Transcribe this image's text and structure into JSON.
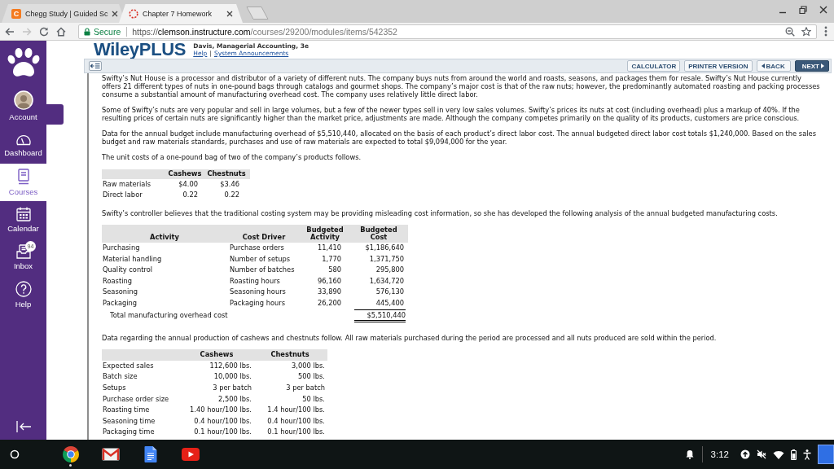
{
  "browser": {
    "tabs": [
      {
        "kind": "letter",
        "icon_text": "C",
        "title": "Chegg Study | Guided Sc",
        "selected": false
      },
      {
        "kind": "loading",
        "title": "Chapter 7 Homework",
        "selected": true
      }
    ],
    "forward_disabled": true,
    "secure_label": "Secure",
    "url": {
      "scheme": "https://",
      "host": "clemson.instructure.com",
      "path": "/courses/29200/modules/items/542352"
    }
  },
  "sidebar": {
    "items": [
      {
        "kind": "avatar",
        "label": "Account",
        "selected": false,
        "hovered": true
      },
      {
        "kind": "dashboard",
        "label": "Dashboard",
        "selected": false,
        "hovered": false
      },
      {
        "kind": "courses",
        "label": "Courses",
        "selected": true,
        "hovered": false
      },
      {
        "kind": "calendar",
        "label": "Calendar",
        "selected": false,
        "hovered": false
      },
      {
        "kind": "inbox",
        "label": "Inbox",
        "badge": "94",
        "selected": false,
        "hovered": false
      },
      {
        "kind": "help",
        "label": "Help",
        "selected": false,
        "hovered": false
      }
    ]
  },
  "header": {
    "logo": "WileyPLUS",
    "subtitle": "Davis, Managerial Accounting, 3e",
    "links": [
      "Help",
      "System Announcements"
    ],
    "link_separator": "|"
  },
  "toolbar": {
    "buttons": [
      {
        "kind": "plain",
        "label": "CALCULATOR"
      },
      {
        "kind": "plain",
        "label": "PRINTER VERSION"
      },
      {
        "kind": "back",
        "label": "BACK"
      },
      {
        "kind": "next",
        "label": "NEXT"
      }
    ]
  },
  "problem": {
    "blocks": [
      {
        "kind": "paragraph",
        "text": "Swifty’s Nut House is a processor and distributor of a variety of different nuts. The company buys nuts from around the world and roasts, seasons, and packages them for resale. Swifty’s Nut House currently offers 21 different types of nuts in one-pound bags through catalogs and gourmet shops. The company’s major cost is that of the raw nuts; however, the predominantly automated roasting and packing processes consume a substantial amount of manufacturing overhead cost. The company uses relatively little direct labor."
      },
      {
        "kind": "paragraph",
        "text": "Some of Swifty’s nuts are very popular and sell in large volumes, but a few of the newer types sell in very low sales volumes. Swifty’s prices its nuts at cost (including overhead) plus a markup of 40%. If the resulting prices of certain nuts are significantly higher than the market price, adjustments are made. Although the company competes primarily on the quality of its products, customers are price conscious."
      },
      {
        "kind": "paragraph",
        "text": "Data for the annual budget include manufacturing overhead of $5,510,440, allocated on the basis of each product’s direct labor cost. The annual budgeted direct labor cost totals $1,240,000. Based on the sales budget and raw materials standards, purchases and use of raw materials are expected to total $9,094,000 for the year."
      },
      {
        "kind": "paragraph",
        "text": "The unit costs of a one-pound bag of two of the company’s products follows."
      },
      {
        "kind": "unit_cost_table",
        "columns": [
          {
            "kind": "label"
          },
          {
            "kind": "amount",
            "label": "Cashews"
          },
          {
            "kind": "amount",
            "label": "Chestnuts"
          }
        ],
        "rows": [
          {
            "label": "Raw materials",
            "values": [
              "$4.00",
              "$3.46"
            ]
          },
          {
            "label": "Direct labor",
            "values": [
              "0.22",
              "0.22"
            ]
          }
        ]
      },
      {
        "kind": "paragraph",
        "text": "Swifty’s controller believes that the traditional costing system may be providing misleading cost information, so she has developed the following analysis of the annual budgeted manufacturing costs."
      },
      {
        "kind": "activity_table",
        "columns": [
          {
            "kind": "label",
            "label": "Activity"
          },
          {
            "kind": "text",
            "label": "Cost Driver"
          },
          {
            "kind": "amount",
            "label": "Budgeted Activity"
          },
          {
            "kind": "amount",
            "label": "Budgeted Cost"
          }
        ],
        "rows": [
          {
            "kind": "item",
            "label": "Purchasing",
            "values": [
              "Purchase orders",
              "11,410",
              "$1,186,640"
            ]
          },
          {
            "kind": "item",
            "label": "Material handling",
            "values": [
              "Number of setups",
              "1,770",
              "1,371,750"
            ]
          },
          {
            "kind": "item",
            "label": "Quality control",
            "values": [
              "Number of batches",
              "580",
              "295,800"
            ]
          },
          {
            "kind": "item",
            "label": "Roasting",
            "values": [
              "Roasting hours",
              "96,160",
              "1,634,720"
            ]
          },
          {
            "kind": "item",
            "label": "Seasoning",
            "values": [
              "Seasoning hours",
              "33,890",
              "576,130"
            ]
          },
          {
            "kind": "item",
            "label": "Packaging",
            "values": [
              "Packaging hours",
              "26,200",
              "445,400"
            ]
          },
          {
            "kind": "total",
            "label": "Total manufacturing overhead cost",
            "amount": "$5,510,440"
          }
        ]
      },
      {
        "kind": "paragraph",
        "text": "Data regarding the annual production of cashews and chestnuts follow. All raw materials purchased during the period are processed and all nuts produced are sold within the period."
      },
      {
        "kind": "production_table",
        "columns": [
          {
            "kind": "label"
          },
          {
            "kind": "amount",
            "label": "Cashews"
          },
          {
            "kind": "amount",
            "label": "Chestnuts"
          }
        ],
        "rows": [
          {
            "label": "Expected sales",
            "values": [
              "112,600 lbs.",
              "3,000 lbs."
            ]
          },
          {
            "label": "Batch size",
            "values": [
              "10,000 lbs.",
              "500 lbs."
            ]
          },
          {
            "label": "Setups",
            "values": [
              "3 per batch",
              "3 per batch"
            ]
          },
          {
            "label": "Purchase order size",
            "values": [
              "2,500 lbs.",
              "50 lbs."
            ]
          },
          {
            "label": "Roasting time",
            "values": [
              "1.40 hour/100 lbs.",
              "1.4 hour/100 lbs."
            ]
          },
          {
            "label": "Seasoning time",
            "values": [
              "0.4 hour/100 lbs.",
              "0.4 hour/100 lbs."
            ]
          },
          {
            "label": "Packaging time",
            "values": [
              "0.1 hour/100 lbs.",
              "0.1 hour/100 lbs."
            ]
          }
        ]
      }
    ]
  },
  "taskbar": {
    "apps": [
      {
        "kind": "browser",
        "running": true
      },
      {
        "kind": "mail",
        "running": false
      },
      {
        "kind": "docs",
        "running": false
      },
      {
        "kind": "video",
        "running": false
      }
    ],
    "time": "3:12"
  }
}
